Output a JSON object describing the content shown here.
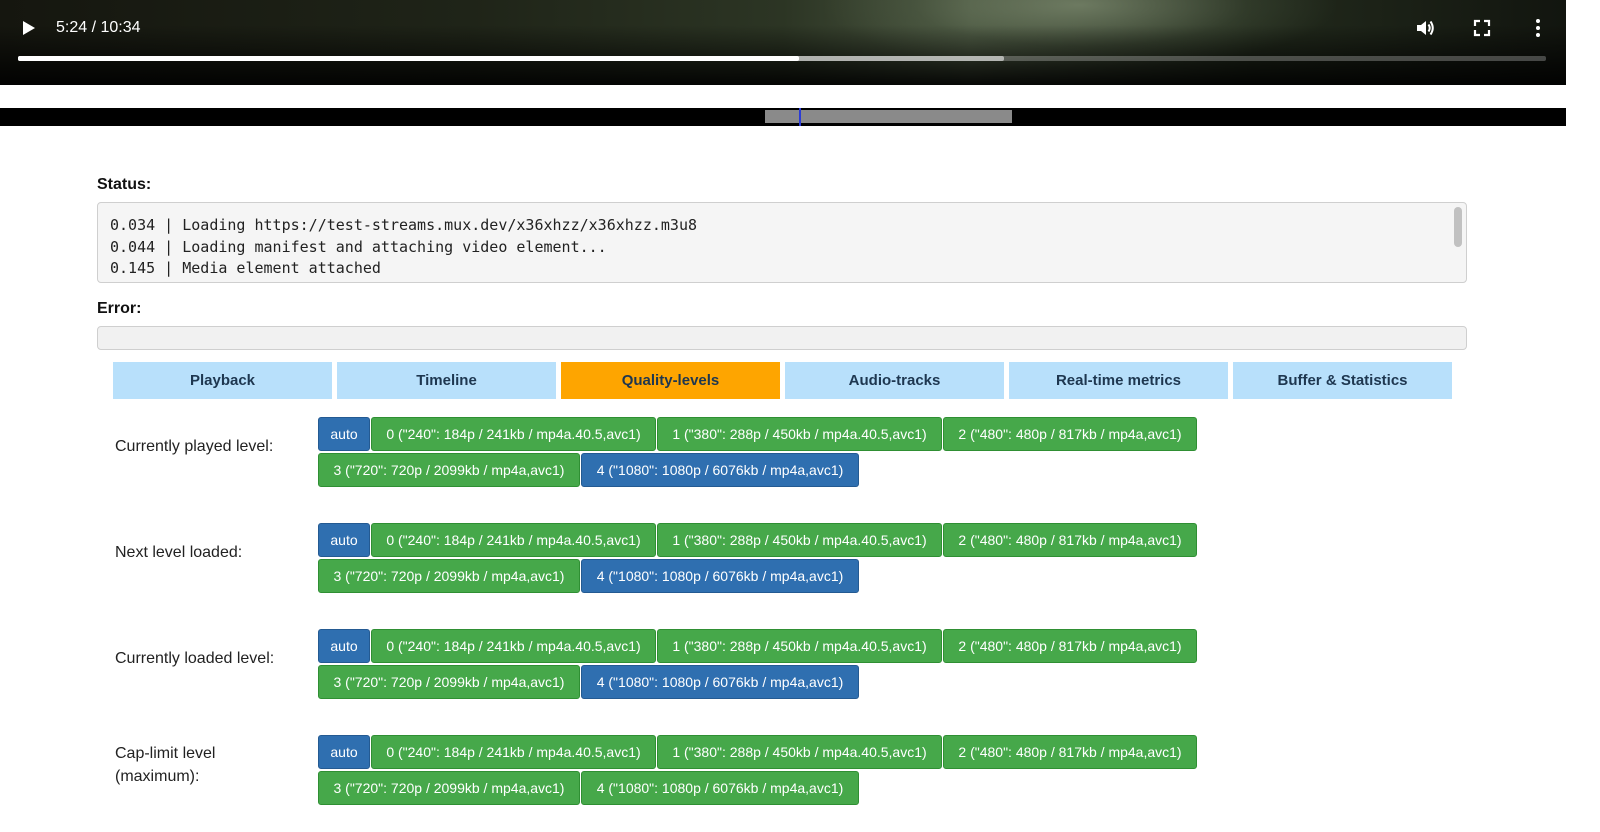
{
  "player": {
    "time": "5:24 / 10:34",
    "progress": {
      "played_fraction": 0.511,
      "buffered_fraction": 0.645
    },
    "icons": {
      "play": "play-icon",
      "volume": "volume-icon",
      "fullscreen": "fullscreen-icon",
      "more": "more-vertical-icon"
    }
  },
  "status": {
    "label": "Status:",
    "lines": [
      "0.034 | Loading https://test-streams.mux.dev/x36xhzz/x36xhzz.m3u8",
      "0.044 | Loading manifest and attaching video element...",
      "0.145 | Media element attached"
    ]
  },
  "error": {
    "label": "Error:",
    "value": ""
  },
  "tabs": [
    {
      "label": "Playback",
      "active": false
    },
    {
      "label": "Timeline",
      "active": false
    },
    {
      "label": "Quality-levels",
      "active": true
    },
    {
      "label": "Audio-tracks",
      "active": false
    },
    {
      "label": "Real-time metrics",
      "active": false
    },
    {
      "label": "Buffer & Statistics",
      "active": false
    }
  ],
  "levels": {
    "auto": "auto",
    "l0": "0 (\"240\": 184p / 241kb / mp4a.40.5,avc1)",
    "l1": "1 (\"380\": 288p / 450kb / mp4a.40.5,avc1)",
    "l2": "2 (\"480\": 480p / 817kb / mp4a,avc1)",
    "l3": "3 (\"720\": 720p / 2099kb / mp4a,avc1)",
    "l4": "4 (\"1080\": 1080p / 6076kb / mp4a,avc1)"
  },
  "groups": {
    "currently_played": {
      "label": "Currently played level:",
      "selected": [
        "auto",
        "l4"
      ]
    },
    "next_loaded": {
      "label": "Next level loaded:",
      "selected": [
        "auto",
        "l4"
      ]
    },
    "currently_loaded": {
      "label": "Currently loaded level:",
      "selected": [
        "auto",
        "l4"
      ]
    },
    "cap_limit": {
      "label_line1": "Cap-limit level",
      "label_line2": "(maximum):",
      "selected": [
        "auto"
      ]
    }
  },
  "colors": {
    "tab_default": "#b8e0fb",
    "tab_active": "#fea500",
    "level_green": "#46a84a",
    "level_blue": "#2f6fb0"
  }
}
